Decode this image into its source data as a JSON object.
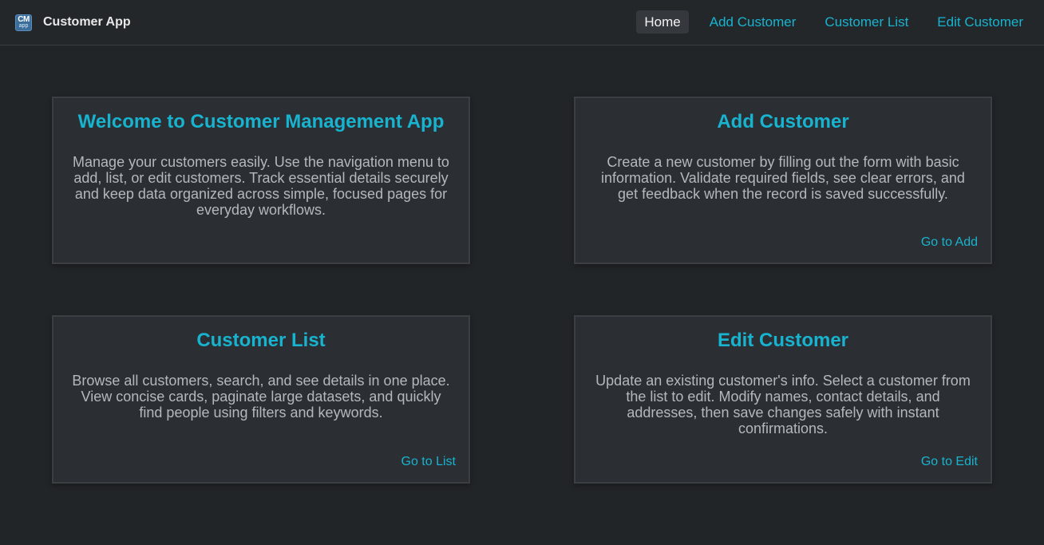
{
  "app": {
    "logo_top": "CM",
    "logo_bottom": "app",
    "name": "Customer App"
  },
  "nav": {
    "items": [
      {
        "label": "Home",
        "active": true
      },
      {
        "label": "Add Customer",
        "active": false
      },
      {
        "label": "Customer List",
        "active": false
      },
      {
        "label": "Edit Customer",
        "active": false
      }
    ]
  },
  "cards": [
    {
      "title": "Welcome to Customer Management App",
      "text": "Manage your customers easily. Use the navigation menu to add, list, or edit customers. Track essential details securely and keep data organized across simple, focused pages for everyday workflows.",
      "link": ""
    },
    {
      "title": "Add Customer",
      "text": "Create a new customer by filling out the form with basic information. Validate required fields, see clear errors, and get feedback when the record is saved successfully.",
      "link": "Go to Add"
    },
    {
      "title": "Customer List",
      "text": "Browse all customers, search, and see details in one place. View concise cards, paginate large datasets, and quickly find people using filters and keywords.",
      "link": "Go to List"
    },
    {
      "title": "Edit Customer",
      "text": "Update an existing customer's info. Select a customer from the list to edit. Modify names, contact details, and addresses, then save changes safely with instant confirmations.",
      "link": "Go to Edit"
    }
  ],
  "colors": {
    "accent": "#17b3cf",
    "background": "#222528",
    "card": "#2b2f33",
    "text_muted": "#b4b8bc"
  }
}
